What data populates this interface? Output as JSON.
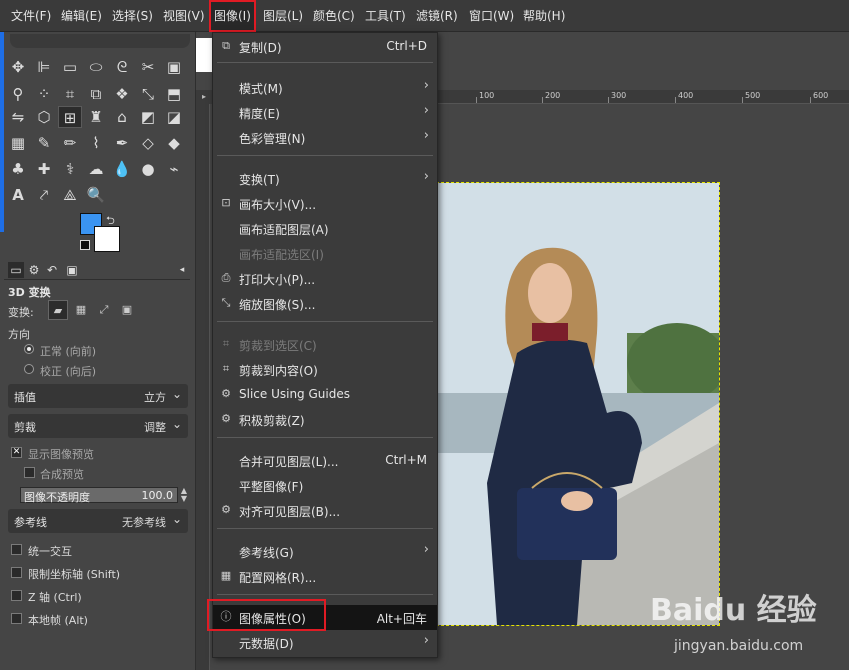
{
  "menubar": {
    "items": [
      "文件(F)",
      "编辑(E)",
      "选择(S)",
      "视图(V)",
      "图像(I)",
      "图层(L)",
      "颜色(C)",
      "工具(T)",
      "滤镜(R)",
      "窗口(W)",
      "帮助(H)"
    ],
    "active_index": 4
  },
  "image_menu": {
    "items": [
      {
        "label": "复制(D)",
        "accel": "Ctrl+D",
        "icon": "duplicate-icon"
      },
      {
        "label": "模式(M)",
        "submenu": true
      },
      {
        "label": "精度(E)",
        "submenu": true
      },
      {
        "label": "色彩管理(N)",
        "submenu": true
      },
      {
        "label": "变换(T)",
        "submenu": true
      },
      {
        "label": "画布大小(V)...",
        "icon": "canvas-size-icon"
      },
      {
        "label": "画布适配图层(A)"
      },
      {
        "label": "画布适配选区(I)",
        "disabled": true
      },
      {
        "label": "打印大小(P)...",
        "icon": "print-size-icon"
      },
      {
        "label": "缩放图像(S)...",
        "icon": "scale-image-icon"
      },
      {
        "label": "剪裁到选区(C)",
        "disabled": true,
        "icon": "crop-selection-icon"
      },
      {
        "label": "剪裁到内容(O)",
        "icon": "crop-content-icon"
      },
      {
        "label": "Slice Using Guides",
        "icon": "slice-guides-icon"
      },
      {
        "label": "积极剪裁(Z)",
        "icon": "zealous-crop-icon"
      },
      {
        "label": "合并可见图层(L)...",
        "accel": "Ctrl+M"
      },
      {
        "label": "平整图像(F)"
      },
      {
        "label": "对齐可见图层(B)...",
        "icon": "align-layers-icon"
      },
      {
        "label": "参考线(G)",
        "submenu": true
      },
      {
        "label": "配置网格(R)...",
        "icon": "grid-icon"
      },
      {
        "label": "图像属性(O)",
        "accel": "Alt+回车",
        "icon": "info-icon",
        "highlighted": true
      },
      {
        "label": "元数据(D)",
        "submenu": true
      }
    ]
  },
  "tool_options": {
    "title": "3D 变换",
    "transform_label": "变换:",
    "direction_label": "方向",
    "direction_normal": "正常 (向前)",
    "direction_corrective": "校正 (向后)",
    "interpolation_label": "插值",
    "interpolation_value": "立方",
    "clipping_label": "剪裁",
    "clipping_value": "调整",
    "show_preview": "显示图像预览",
    "composited_preview": "合成预览",
    "opacity_label": "图像不透明度",
    "opacity_value": "100.0",
    "guides_label": "参考线",
    "guides_value": "无参考线",
    "unified_interaction": "统一交互",
    "constrain_axis": "限制坐标轴 (Shift)",
    "z_axis": "Z 轴 (Ctrl)",
    "local_frame": "本地帧 (Alt)"
  },
  "ruler": {
    "ticks": [
      "100",
      "200",
      "300",
      "400",
      "500",
      "600"
    ]
  },
  "watermark": {
    "brand": "Baidu 经验",
    "url": "jingyan.baidu.com"
  },
  "colors": {
    "foreground": "#3a94f2",
    "background": "#ffffff",
    "highlight_box": "#e01b24"
  }
}
